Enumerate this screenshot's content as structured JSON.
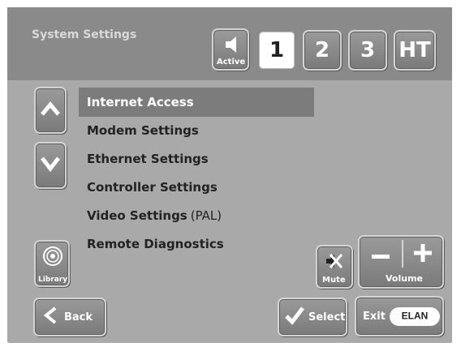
{
  "header": {
    "title": "System Settings",
    "active_label": "Active",
    "zones": [
      "1",
      "2",
      "3",
      "HT"
    ],
    "selected_zone": "1"
  },
  "menu": {
    "items": [
      {
        "label": "Internet Access",
        "suffix": ""
      },
      {
        "label": "Modem Settings",
        "suffix": ""
      },
      {
        "label": "Ethernet Settings",
        "suffix": ""
      },
      {
        "label": "Controller Settings",
        "suffix": ""
      },
      {
        "label": "Video Settings",
        "suffix": "(PAL)"
      },
      {
        "label": "Remote Diagnostics",
        "suffix": ""
      }
    ],
    "selected": "Internet Access"
  },
  "controls": {
    "library_label": "Library",
    "mute_label": "Mute",
    "volume_label": "Volume",
    "back_label": "Back",
    "select_label": "Select",
    "exit_label": "Exit",
    "brand_logo": "ELAN"
  },
  "icons": {
    "speaker": "speaker-icon",
    "up": "up-arrow-icon",
    "down": "down-arrow-icon",
    "library": "disc-icon",
    "mute": "mute-x-icon",
    "back": "left-chevron-icon",
    "select": "checkmark-icon"
  },
  "colors": {
    "background": "#a9a9a9",
    "header": "#8a8a8a",
    "highlight": "#7c7c7c"
  }
}
